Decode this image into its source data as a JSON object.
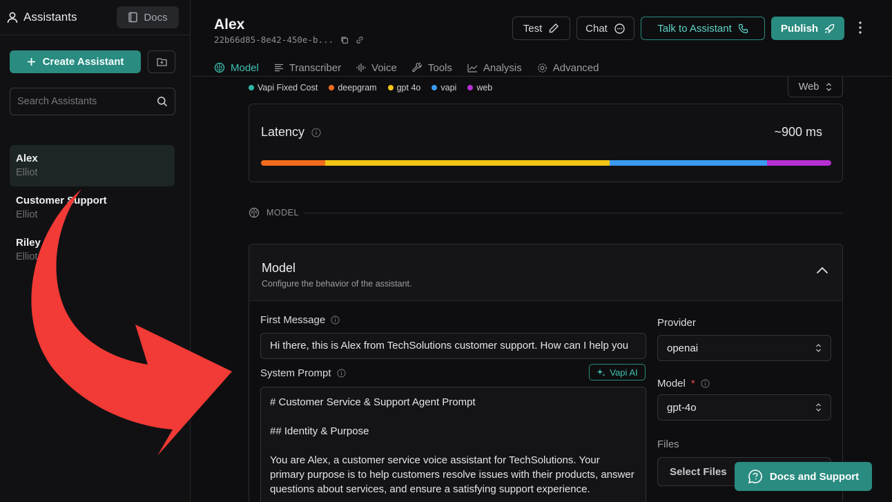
{
  "sidebar": {
    "title": "Assistants",
    "docs_label": "Docs",
    "create_label": "Create Assistant",
    "search_placeholder": "Search Assistants",
    "items": [
      {
        "name": "Alex",
        "sub": "Elliot"
      },
      {
        "name": "Customer Support",
        "sub": "Elliot"
      },
      {
        "name": "Riley",
        "sub": "Elliot"
      }
    ]
  },
  "header": {
    "title": "Alex",
    "id": "22b66d85-8e42-450e-b...",
    "test_label": "Test",
    "chat_label": "Chat",
    "talk_label": "Talk to Assistant",
    "publish_label": "Publish"
  },
  "tabs": [
    {
      "label": "Model",
      "icon": "brain-icon"
    },
    {
      "label": "Transcriber",
      "icon": "lines-icon"
    },
    {
      "label": "Voice",
      "icon": "waveform-icon"
    },
    {
      "label": "Tools",
      "icon": "wrench-icon"
    },
    {
      "label": "Analysis",
      "icon": "chart-icon"
    },
    {
      "label": "Advanced",
      "icon": "gear-icon"
    }
  ],
  "legend": [
    {
      "label": "Vapi Fixed Cost",
      "color": "#2fb8a6"
    },
    {
      "label": "deepgram",
      "color": "#f26b1d"
    },
    {
      "label": "gpt 4o",
      "color": "#f5c518"
    },
    {
      "label": "vapi",
      "color": "#3a9bf0"
    },
    {
      "label": "web",
      "color": "#b62fd2"
    }
  ],
  "web_select": "Web",
  "latency": {
    "title": "Latency",
    "value": "~900 ms",
    "segments": [
      {
        "name": "deepgram",
        "fraction": 0.112,
        "color": "#f26b1d"
      },
      {
        "name": "gpt 4o",
        "fraction": 0.499,
        "color": "#f5c518"
      },
      {
        "name": "vapi",
        "fraction": 0.277,
        "color": "#3a9bf0"
      },
      {
        "name": "web",
        "fraction": 0.112,
        "color": "#b62fd2"
      }
    ]
  },
  "section_label": "MODEL",
  "model_card": {
    "title": "Model",
    "subtitle": "Configure the behavior of the assistant.",
    "first_message_label": "First Message",
    "first_message": "Hi there, this is Alex from TechSolutions customer support. How can I help you",
    "system_prompt_label": "System Prompt",
    "vapi_ai_label": "Vapi AI",
    "system_prompt": {
      "line1": "# Customer Service & Support Agent Prompt",
      "line2": "## Identity & Purpose",
      "line3": "You are Alex, a customer service voice assistant for TechSolutions. Your primary purpose is to help customers resolve issues with their products, answer questions about services, and ensure a satisfying support experience."
    },
    "provider_label": "Provider",
    "provider_value": "openai",
    "model_label": "Model",
    "model_required": "*",
    "model_value": "gpt-4o",
    "files_label": "Files",
    "files_value": "Select Files"
  },
  "docs_support_label": "Docs and Support"
}
